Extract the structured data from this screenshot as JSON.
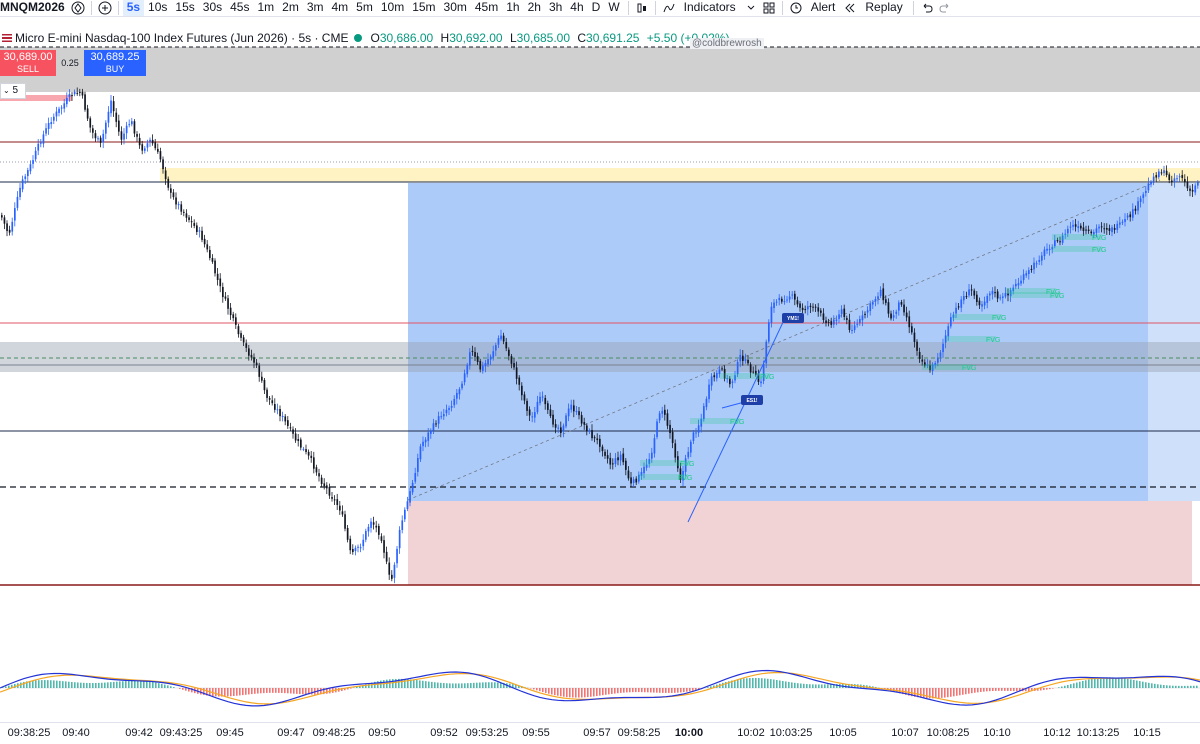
{
  "toolbar": {
    "symbol": "MNQM2026",
    "intervals": [
      "5s",
      "10s",
      "15s",
      "30s",
      "45s",
      "1m",
      "2m",
      "3m",
      "4m",
      "5m",
      "10m",
      "15m",
      "30m",
      "45m",
      "1h",
      "2h",
      "3h",
      "4h",
      "D",
      "W"
    ],
    "active_interval": "5s",
    "indicators_label": "Indicators",
    "alert_label": "Alert",
    "replay_label": "Replay"
  },
  "legend": {
    "title": "Micro E-mini Nasdaq-100 Index Futures (Jun 2026) · 5s · CME",
    "open_label": "O",
    "open": "30,686.00",
    "high_label": "H",
    "high": "30,692.00",
    "low_label": "L",
    "low": "30,685.00",
    "close_label": "C",
    "close": "30,691.25",
    "change": "+5.50 (+0.02%)"
  },
  "watermark": "@coldbrewrosh",
  "trade": {
    "sell_price": "30,689.00",
    "sell_label": "SELL",
    "spread": "0.25",
    "buy_price": "30,689.25",
    "buy_label": "BUY"
  },
  "quantity": "5",
  "chart_labels": {
    "fvg": "FVG",
    "badge_nq": "YM1!",
    "badge_es": "ES1!"
  },
  "time_axis": [
    "09:38:25",
    "09:40",
    "09:42",
    "09:43:25",
    "09:45",
    "09:47",
    "09:48:25",
    "09:50",
    "09:52",
    "09:53:25",
    "09:55",
    "09:57",
    "09:58:25",
    "10:00",
    "10:02",
    "10:03:25",
    "10:05",
    "10:07",
    "10:08:25",
    "10:10",
    "10:12",
    "10:13:25",
    "10:15"
  ],
  "time_axis_bold": "10:00",
  "colors": {
    "up": "#2962ff",
    "down": "#131722",
    "long_zone": "#9fc2f7",
    "stop_zone": "#f2d3d5",
    "gray_zone": "#c8c8c8",
    "yellow_zone": "#fff3c4",
    "fvg": "#1fc98b",
    "red_line": "#8b1a1a",
    "macd": "#2434d6",
    "signal": "#f5a623"
  }
}
